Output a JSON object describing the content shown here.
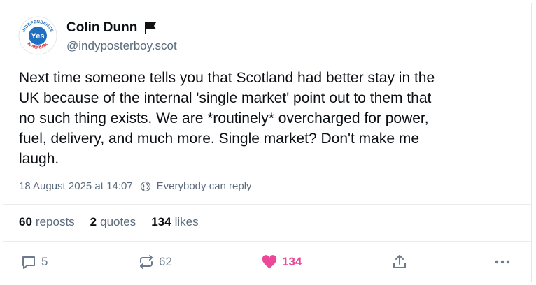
{
  "author": {
    "display_name": "Colin Dunn",
    "handle": "@indyposterboy.scot",
    "avatar_text_top": "INDEPENDENCE",
    "avatar_text_center": "Yes",
    "avatar_text_bottom": "IS NORMAL",
    "flag_icon": "black-flag-icon"
  },
  "post": {
    "text": "Next time someone tells you that Scotland had better stay in the\nUK because of the internal 'single market' point out to them that\nno such thing exists. We are *routinely* overcharged for power,\nfuel, delivery, and much more. Single market? Don't make me\nlaugh.",
    "timestamp": "18 August 2025 at 14:07",
    "reply_setting": "Everybody can reply"
  },
  "stats": {
    "reposts_count": "60",
    "reposts_label": "reposts",
    "quotes_count": "2",
    "quotes_label": "quotes",
    "likes_count": "134",
    "likes_label": "likes"
  },
  "actions": {
    "reply_count": "5",
    "repost_count": "62",
    "like_count": "134",
    "share_icon": "share-icon",
    "more_icon": "more-icon"
  },
  "colors": {
    "like_active": "#ec4899",
    "muted": "#5b6b7c",
    "avatar_blue": "#1f6fc2",
    "avatar_red": "#d7262e"
  }
}
